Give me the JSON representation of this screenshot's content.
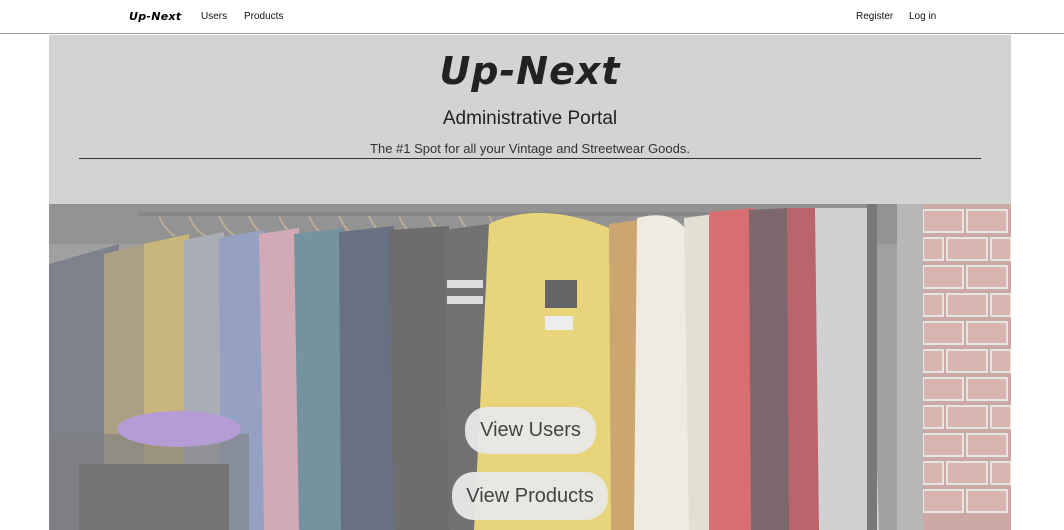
{
  "nav": {
    "brand": "Up-Next",
    "links": [
      {
        "label": "Users"
      },
      {
        "label": "Products"
      }
    ],
    "right_links": [
      {
        "label": "Register"
      },
      {
        "label": "Log in"
      }
    ]
  },
  "hero": {
    "title": "Up-Next",
    "subtitle": "Administrative Portal",
    "tagline": "The #1 Spot for all your Vintage and Streetwear Goods.",
    "buttons": [
      {
        "label": "View Users"
      },
      {
        "label": "View Products"
      }
    ]
  },
  "colors": {
    "header_bg": "#d3d3d3",
    "button_bg": "#e8e8e8",
    "text": "#222222"
  }
}
